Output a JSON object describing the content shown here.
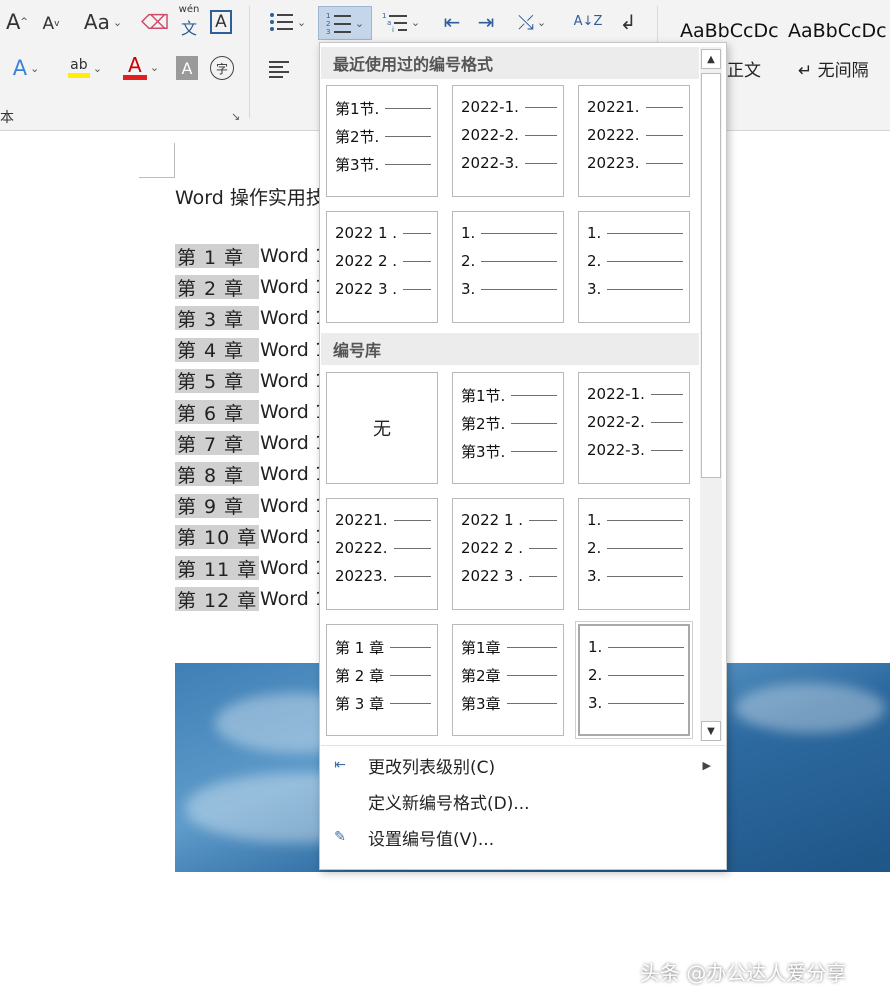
{
  "ribbon": {
    "font_group": {
      "grow_icon": "A",
      "shrink_icon": "A",
      "change_case_icon": "Aa",
      "pinyin_top": "wén",
      "pinyin_char": "文",
      "char_border": "A",
      "text_effects_icon": "A",
      "highlight_icon": "ab",
      "font_color_icon": "A",
      "char_shading_icon": "A",
      "enclose_icon": "字",
      "group_label": "本"
    },
    "paragraph_group": {
      "increase_indent": "⇥",
      "decrease_indent": "⇤",
      "sort_icon": "A↓Z",
      "show_marks_icon": "↲"
    },
    "styles": [
      {
        "sample": "AaBbCcDc",
        "name": "正文"
      },
      {
        "sample": "AaBbCcDc",
        "name": "↵ 无间隔"
      }
    ],
    "highlight_color": "#ffee00",
    "font_color": "#e02020"
  },
  "document": {
    "title": "Word 操作实用技",
    "lines": [
      {
        "chapter": "第 1 章",
        "text": "Word 1"
      },
      {
        "chapter": "第 2 章",
        "text": "Word 1"
      },
      {
        "chapter": "第 3 章",
        "text": "Word 1"
      },
      {
        "chapter": "第 4 章",
        "text": "Word 1"
      },
      {
        "chapter": "第 5 章",
        "text": "Word 1"
      },
      {
        "chapter": "第 6 章",
        "text": "Word 1"
      },
      {
        "chapter": "第 7 章",
        "text": "Word 1"
      },
      {
        "chapter": "第 8 章",
        "text": "Word 1"
      },
      {
        "chapter": "第 9 章",
        "text": "Word 1"
      },
      {
        "chapter": "第 10 章",
        "text": "Word 1"
      },
      {
        "chapter": "第 11 章",
        "text": "Word 1"
      },
      {
        "chapter": "第 12 章",
        "text": "Word 1"
      }
    ]
  },
  "gallery": {
    "recent_header": "最近使用过的编号格式",
    "library_header": "编号库",
    "recent": [
      [
        "第1节.",
        "第2节.",
        "第3节."
      ],
      [
        "2022-1.",
        "2022-2.",
        "2022-3."
      ],
      [
        "20221.",
        "20222.",
        "20223."
      ],
      [
        "2022 1 .",
        "2022 2 .",
        "2022 3 ."
      ],
      [
        "1.",
        "2.",
        "3."
      ],
      [
        "1.",
        "2.",
        "3."
      ]
    ],
    "none_label": "无",
    "library": [
      [
        "第1节.",
        "第2节.",
        "第3节."
      ],
      [
        "2022-1.",
        "2022-2.",
        "2022-3."
      ],
      [
        "20221.",
        "20222.",
        "20223."
      ],
      [
        "2022 1 .",
        "2022 2 .",
        "2022 3 ."
      ],
      [
        "1.",
        "2.",
        "3."
      ],
      [
        "第 1 章",
        "第 2 章",
        "第 3 章"
      ],
      [
        "第1章",
        "第2章",
        "第3章"
      ],
      [
        "1.",
        "2.",
        "3."
      ]
    ],
    "menu": {
      "change_level": "更改列表级别(C)",
      "define_new": "定义新编号格式(D)...",
      "set_value": "设置编号值(V)..."
    }
  },
  "watermark": "头条 @办公达人爱分享"
}
